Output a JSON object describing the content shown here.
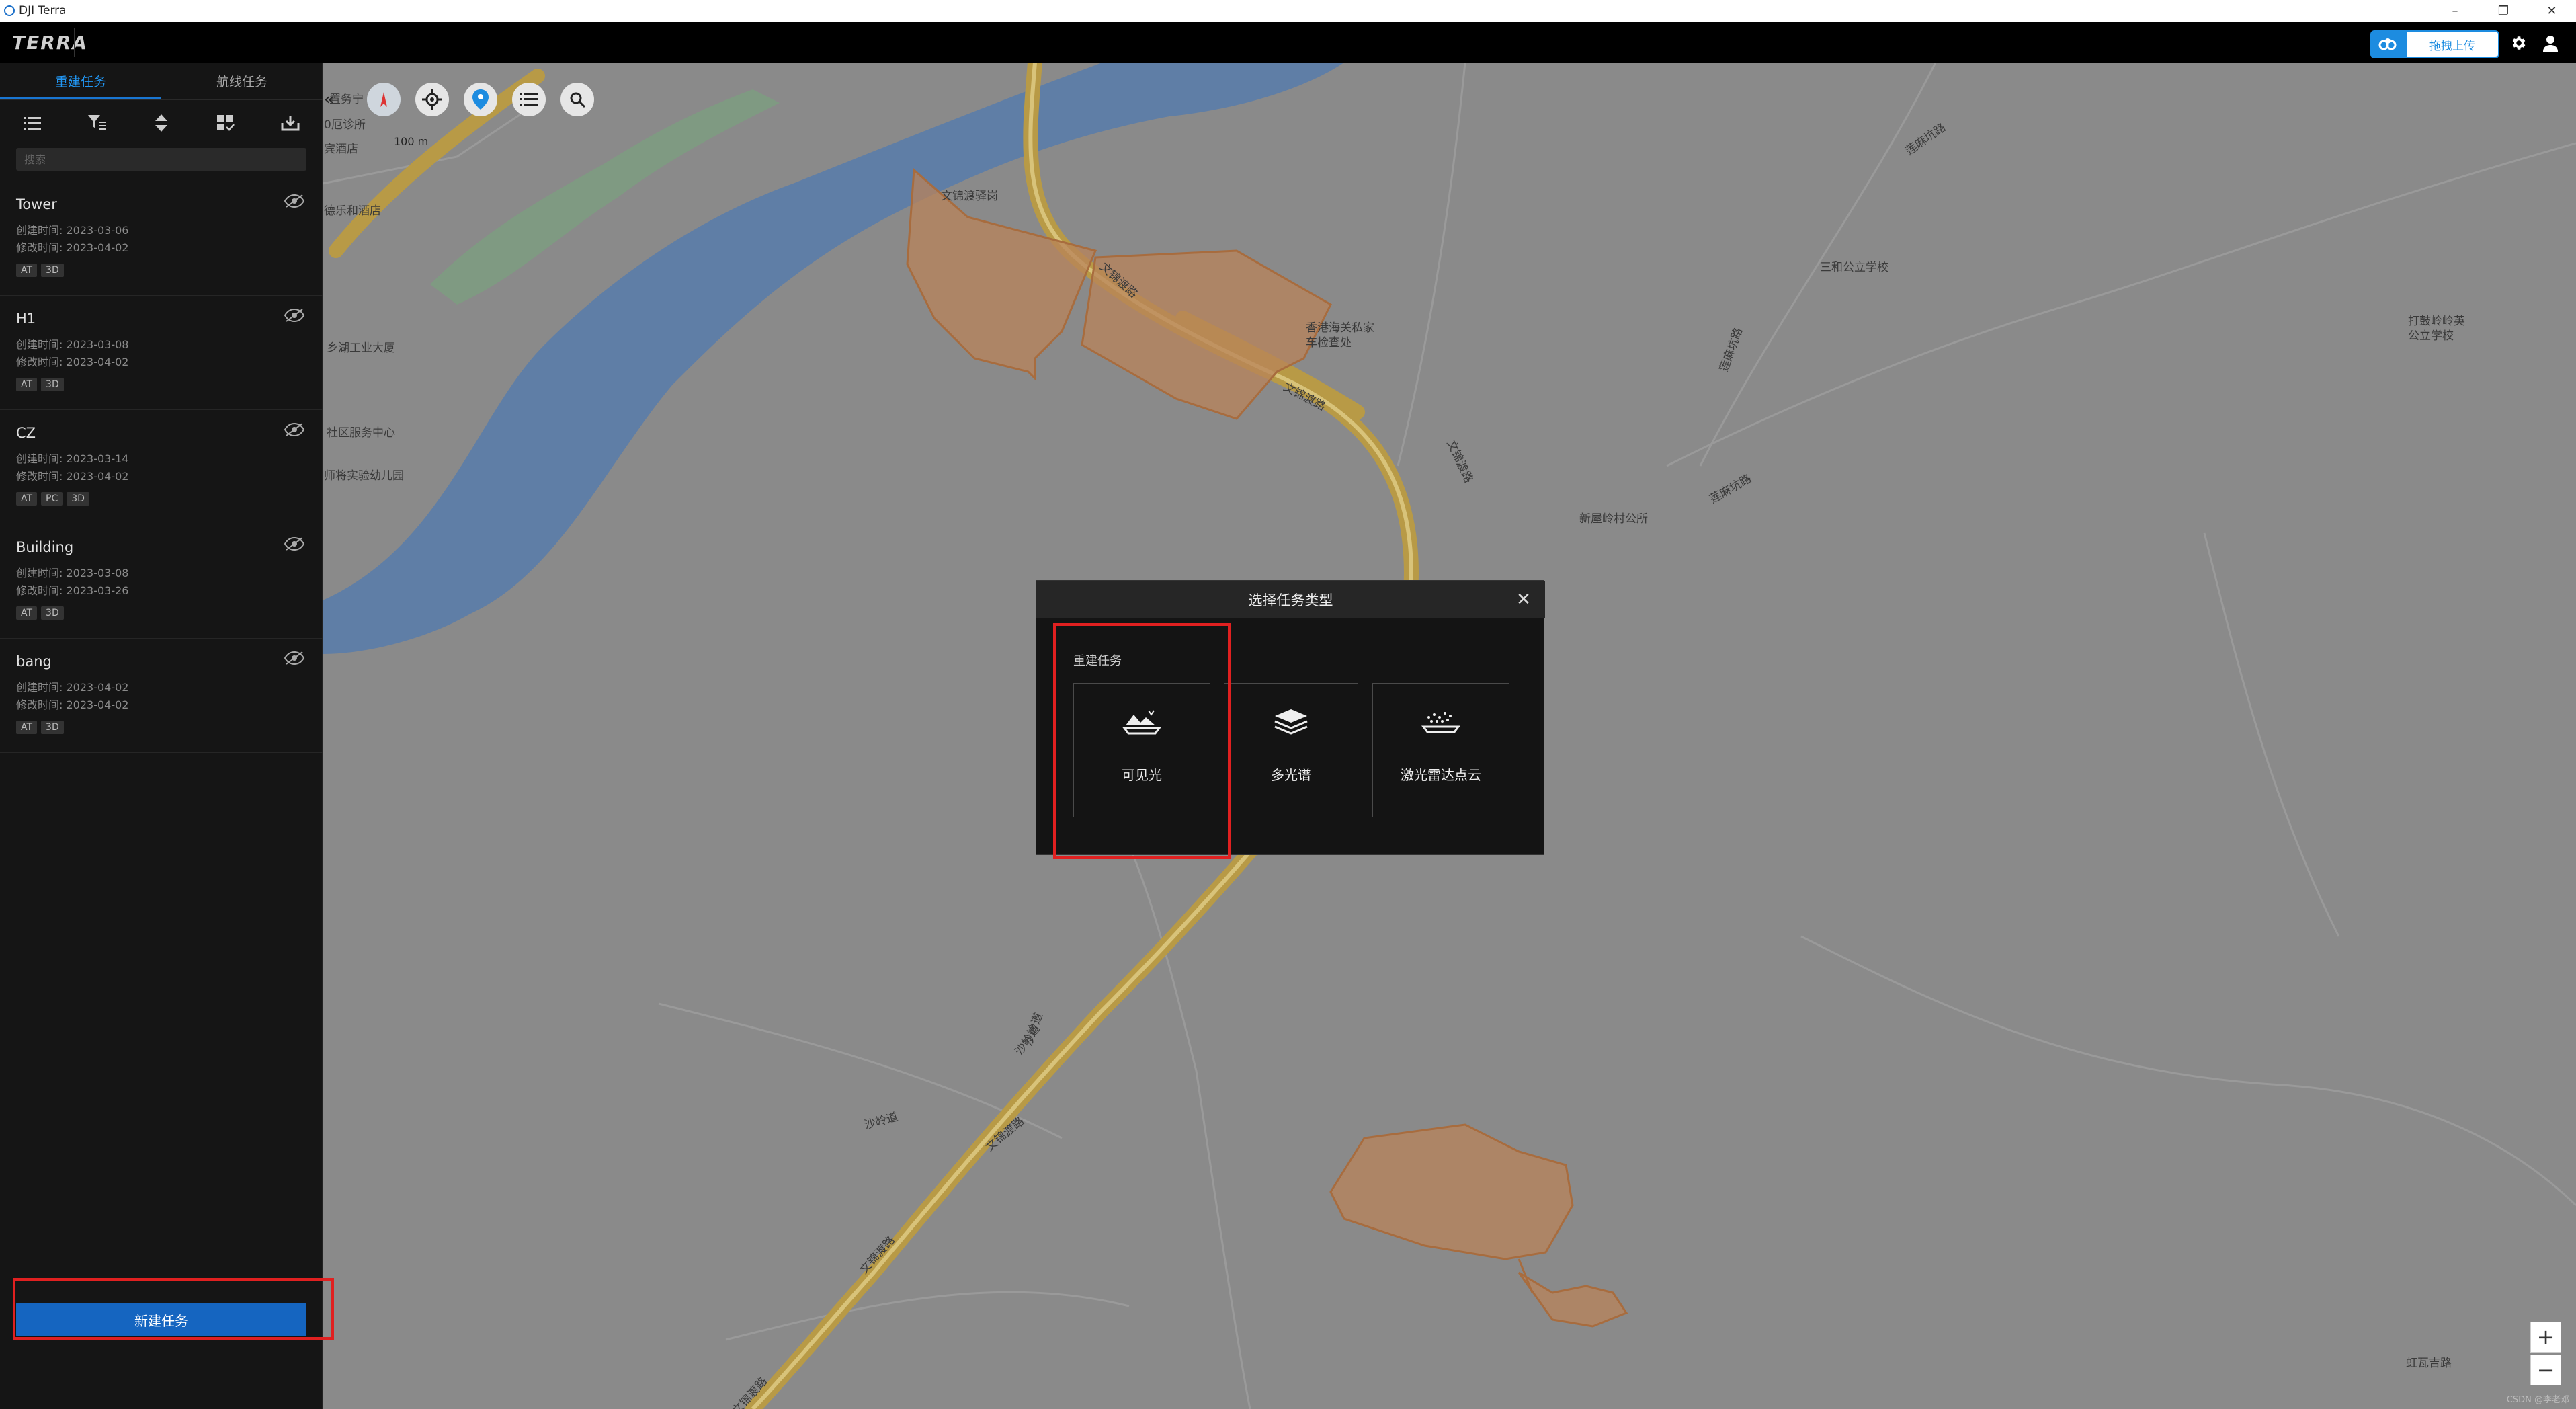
{
  "window": {
    "title": "DJI Terra",
    "controls": [
      "–",
      "❐",
      "✕"
    ]
  },
  "header": {
    "logo": "TERRA",
    "upload_label": "拖拽上传"
  },
  "sidebar": {
    "tabs": [
      {
        "label": "重建任务",
        "active": true
      },
      {
        "label": "航线任务",
        "active": false
      }
    ],
    "toolbar": [
      "list-icon",
      "filter-icon",
      "sort-icon",
      "grid-select-icon",
      "import-icon"
    ],
    "search_placeholder": "搜索",
    "tasks": [
      {
        "name": "Tower",
        "created": "创建时间: 2023-03-06",
        "modified": "修改时间: 2023-04-02",
        "tags": [
          "AT",
          "3D"
        ]
      },
      {
        "name": "H1",
        "created": "创建时间: 2023-03-08",
        "modified": "修改时间: 2023-04-02",
        "tags": [
          "AT",
          "3D"
        ]
      },
      {
        "name": "CZ",
        "created": "创建时间: 2023-03-14",
        "modified": "修改时间: 2023-04-02",
        "tags": [
          "AT",
          "PC",
          "3D"
        ]
      },
      {
        "name": "Building",
        "created": "创建时间: 2023-03-08",
        "modified": "修改时间: 2023-03-26",
        "tags": [
          "AT",
          "3D"
        ]
      },
      {
        "name": "bang",
        "created": "创建时间: 2023-04-02",
        "modified": "修改时间: 2023-04-02",
        "tags": [
          "AT",
          "3D"
        ]
      }
    ],
    "new_task_label": "新建任务"
  },
  "map": {
    "collapse_label": "«",
    "scale_label": "100 m",
    "labels": [
      {
        "text": "置务宁"
      },
      {
        "text": "0厄诊所"
      },
      {
        "text": "宾酒店"
      },
      {
        "text": "德乐和酒店"
      },
      {
        "text": "文锦渡驿岗"
      },
      {
        "text": "香港海关私家"
      },
      {
        "text": "车检查处"
      },
      {
        "text": "文锦渡路"
      },
      {
        "text": "文锦渡路"
      },
      {
        "text": "文锦渡路"
      },
      {
        "text": "乡湖工业大厦"
      },
      {
        "text": "社区服务中心"
      },
      {
        "text": "师将实验幼儿园"
      },
      {
        "text": "三和公立学校"
      },
      {
        "text": "打鼓岭岭英"
      },
      {
        "text": "公立学校"
      },
      {
        "text": "莲麻坑路"
      },
      {
        "text": "莲麻坑路"
      },
      {
        "text": "莲麻坑路"
      },
      {
        "text": "新屋岭村公所"
      },
      {
        "text": "沙岭道"
      },
      {
        "text": "沙岭道"
      },
      {
        "text": "沙岭道"
      },
      {
        "text": "文锦渡路"
      },
      {
        "text": "文锦渡路"
      },
      {
        "text": "文锦渡路"
      },
      {
        "text": "虹瓦吉路"
      }
    ],
    "zoom_in": "+",
    "zoom_out": "−",
    "watermark": "CSDN @李老邓"
  },
  "dialog": {
    "title": "选择任务类型",
    "close": "✕",
    "section": "重建任务",
    "types": [
      {
        "label": "可见光"
      },
      {
        "label": "多光谱"
      },
      {
        "label": "激光雷达点云"
      }
    ]
  },
  "colors": {
    "accent": "#1976d2",
    "highlight": "#e02020",
    "water": "#5f7ea6",
    "road": "#b89a46",
    "zone": "#b8835a"
  }
}
